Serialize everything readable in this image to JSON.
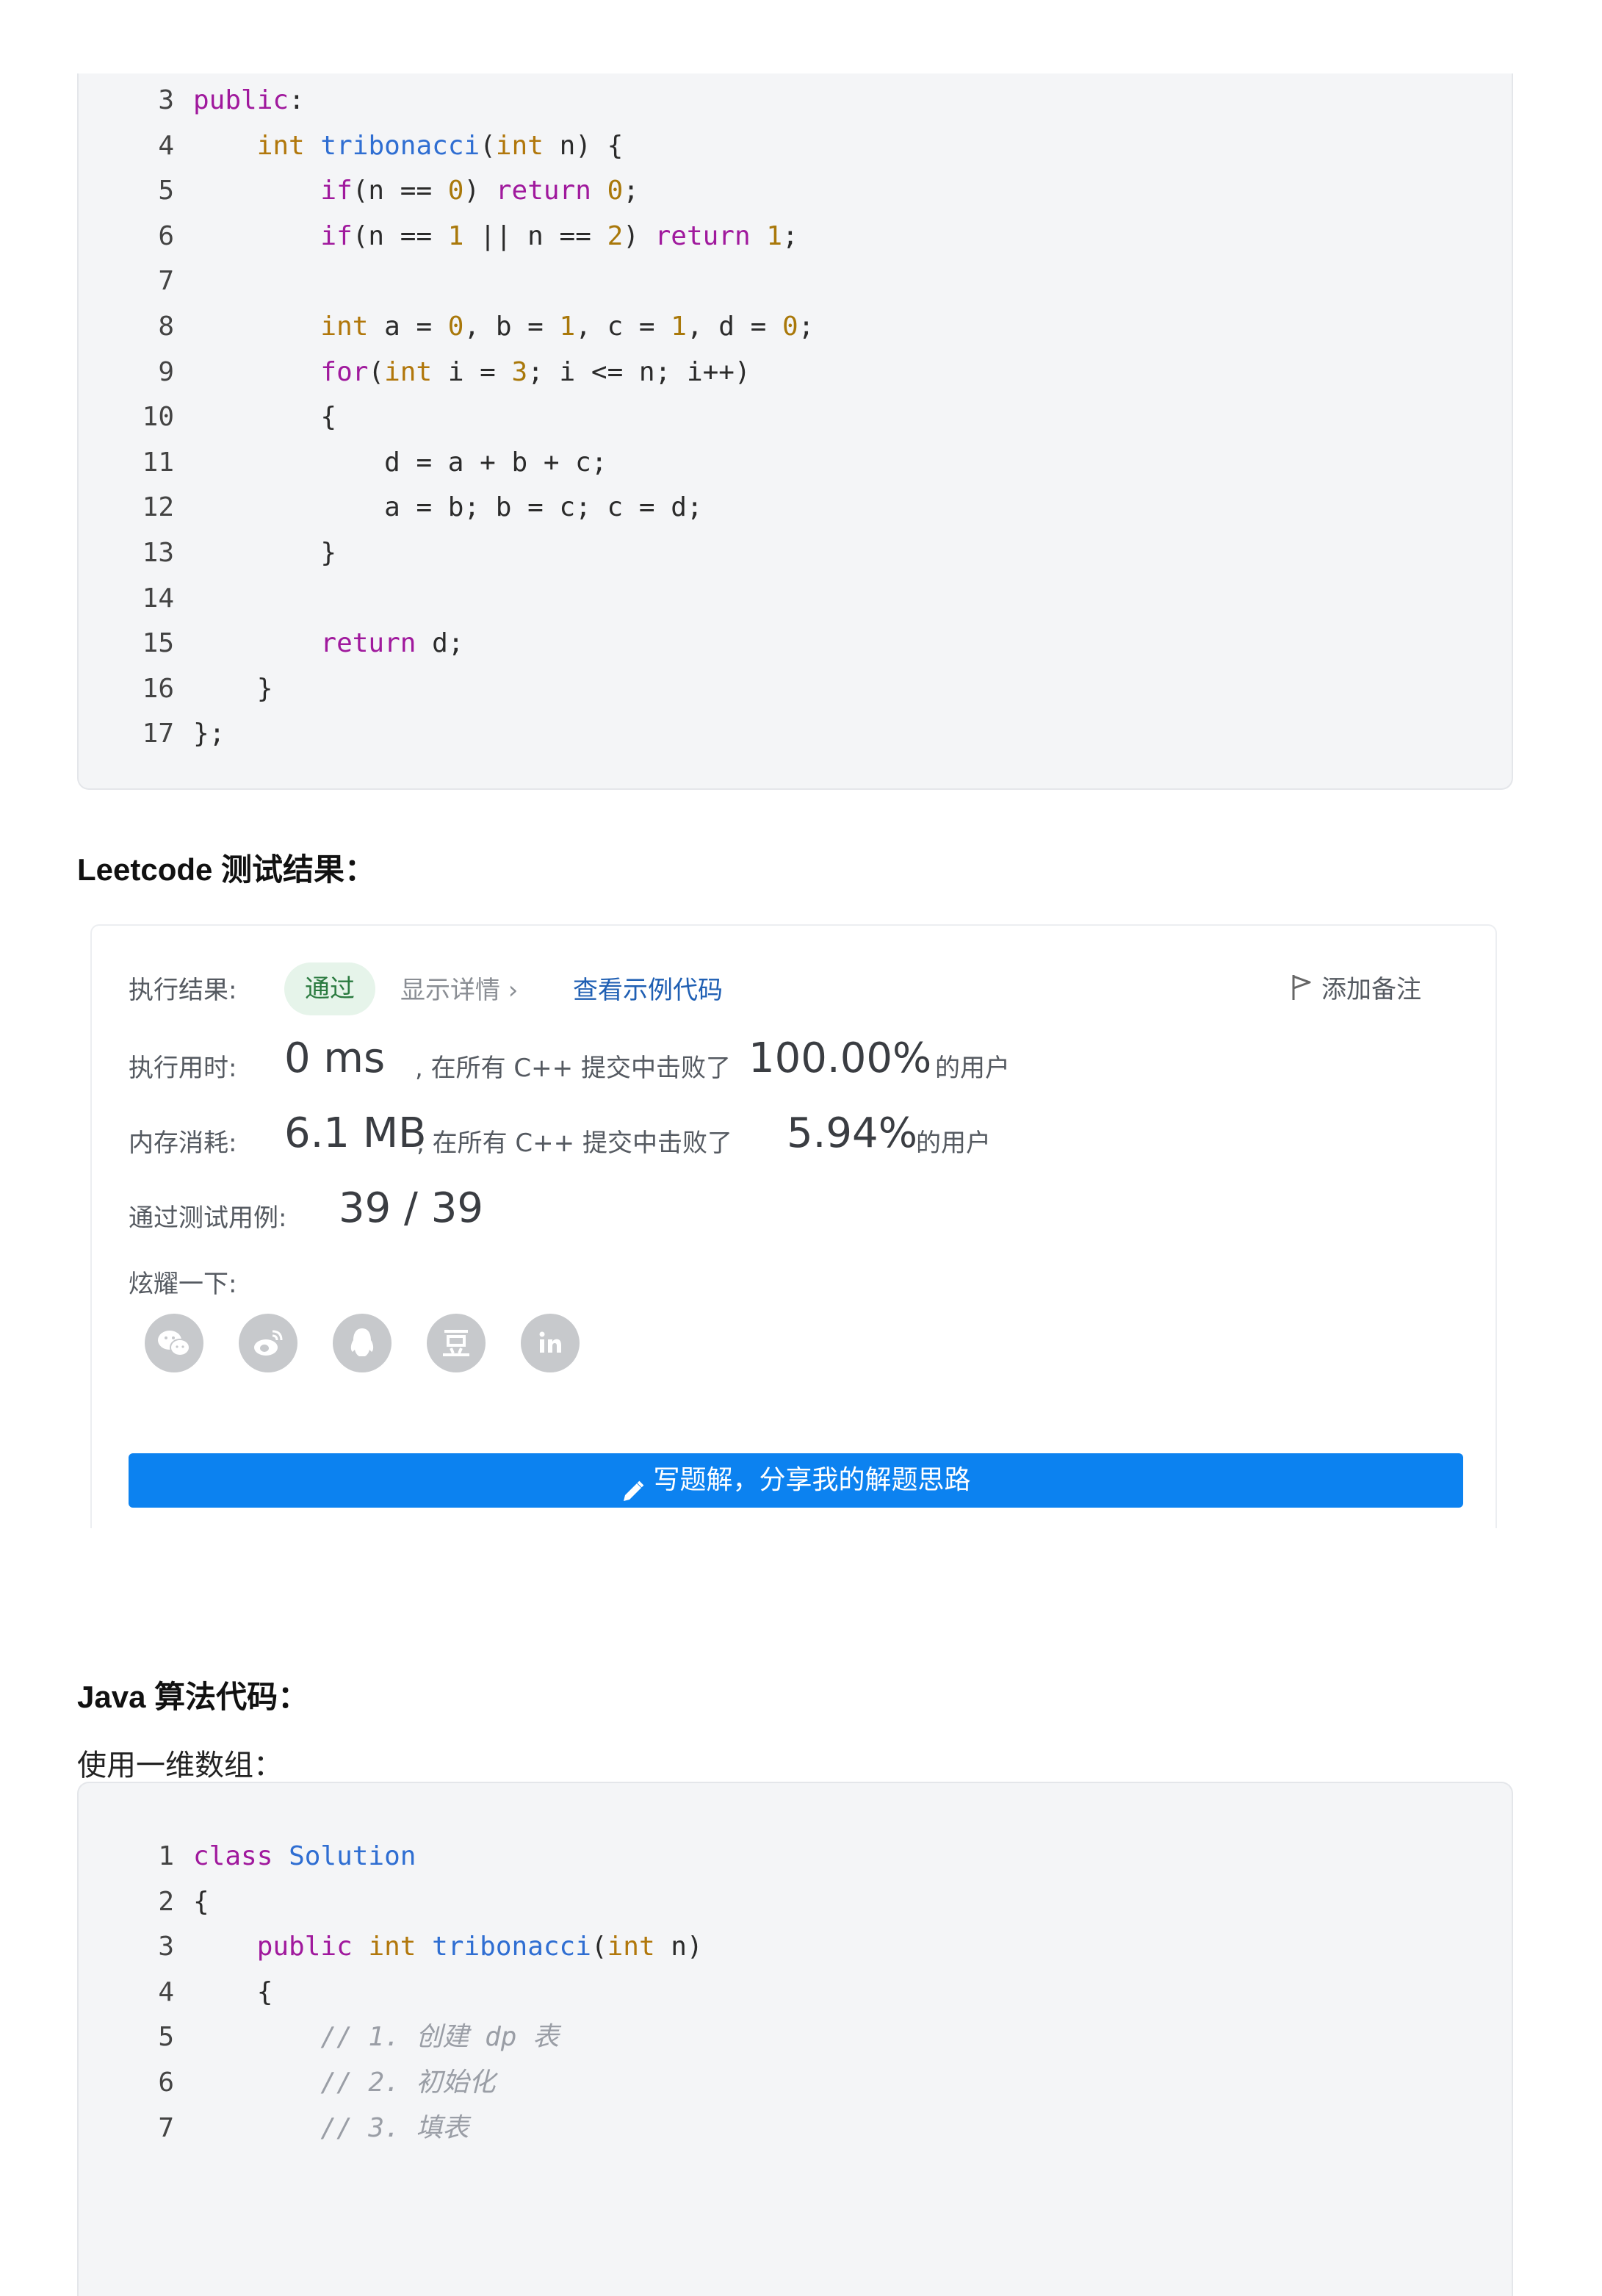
{
  "code_block_1": {
    "lines": [
      {
        "n": "3",
        "indent": 0,
        "tokens": [
          {
            "t": "public",
            "c": "kw"
          },
          {
            "t": ":",
            "c": ""
          }
        ]
      },
      {
        "n": "4",
        "indent": 1,
        "tokens": [
          {
            "t": "int",
            "c": "ty"
          },
          {
            "t": " ",
            "c": ""
          },
          {
            "t": "tribonacci",
            "c": "fn"
          },
          {
            "t": "(",
            "c": ""
          },
          {
            "t": "int",
            "c": "ty"
          },
          {
            "t": " n) {",
            "c": ""
          }
        ]
      },
      {
        "n": "5",
        "indent": 2,
        "tokens": [
          {
            "t": "if",
            "c": "kw"
          },
          {
            "t": "(n == ",
            "c": ""
          },
          {
            "t": "0",
            "c": "num"
          },
          {
            "t": ") ",
            "c": ""
          },
          {
            "t": "return",
            "c": "kw"
          },
          {
            "t": " ",
            "c": ""
          },
          {
            "t": "0",
            "c": "num"
          },
          {
            "t": ";",
            "c": ""
          }
        ]
      },
      {
        "n": "6",
        "indent": 2,
        "tokens": [
          {
            "t": "if",
            "c": "kw"
          },
          {
            "t": "(n == ",
            "c": ""
          },
          {
            "t": "1",
            "c": "num"
          },
          {
            "t": " || n == ",
            "c": ""
          },
          {
            "t": "2",
            "c": "num"
          },
          {
            "t": ") ",
            "c": ""
          },
          {
            "t": "return",
            "c": "kw"
          },
          {
            "t": " ",
            "c": ""
          },
          {
            "t": "1",
            "c": "num"
          },
          {
            "t": ";",
            "c": ""
          }
        ]
      },
      {
        "n": "7",
        "indent": 0,
        "tokens": []
      },
      {
        "n": "8",
        "indent": 2,
        "tokens": [
          {
            "t": "int",
            "c": "ty"
          },
          {
            "t": " a = ",
            "c": ""
          },
          {
            "t": "0",
            "c": "num"
          },
          {
            "t": ", b = ",
            "c": ""
          },
          {
            "t": "1",
            "c": "num"
          },
          {
            "t": ", c = ",
            "c": ""
          },
          {
            "t": "1",
            "c": "num"
          },
          {
            "t": ", d = ",
            "c": ""
          },
          {
            "t": "0",
            "c": "num"
          },
          {
            "t": ";",
            "c": ""
          }
        ]
      },
      {
        "n": "9",
        "indent": 2,
        "tokens": [
          {
            "t": "for",
            "c": "kw"
          },
          {
            "t": "(",
            "c": ""
          },
          {
            "t": "int",
            "c": "ty"
          },
          {
            "t": " i = ",
            "c": ""
          },
          {
            "t": "3",
            "c": "num"
          },
          {
            "t": "; i <= n; i++)",
            "c": ""
          }
        ]
      },
      {
        "n": "10",
        "indent": 2,
        "tokens": [
          {
            "t": "{",
            "c": ""
          }
        ]
      },
      {
        "n": "11",
        "indent": 3,
        "tokens": [
          {
            "t": "d = a + b + c;",
            "c": ""
          }
        ]
      },
      {
        "n": "12",
        "indent": 3,
        "tokens": [
          {
            "t": "a = b; b = c; c = d;",
            "c": ""
          }
        ]
      },
      {
        "n": "13",
        "indent": 2,
        "tokens": [
          {
            "t": "}",
            "c": ""
          }
        ]
      },
      {
        "n": "14",
        "indent": 0,
        "tokens": []
      },
      {
        "n": "15",
        "indent": 2,
        "tokens": [
          {
            "t": "return",
            "c": "kw"
          },
          {
            "t": " d;",
            "c": ""
          }
        ]
      },
      {
        "n": "16",
        "indent": 1,
        "tokens": [
          {
            "t": "}",
            "c": ""
          }
        ]
      },
      {
        "n": "17",
        "indent": 0,
        "tokens": [
          {
            "t": "};",
            "c": ""
          }
        ]
      }
    ]
  },
  "heading_leetcode": "Leetcode 测试结果：",
  "result": {
    "status_label": "执行结果:",
    "status_badge": "通过",
    "show_details": "显示详情 ›",
    "view_sample": "查看示例代码",
    "add_note": "添加备注",
    "time_label": "执行用时:",
    "time_value": "0 ms",
    "time_text": ", 在所有 C++ 提交中击败了",
    "time_percent": "100.00%",
    "time_suffix": "的用户",
    "mem_label": "内存消耗:",
    "mem_value": "6.1 MB",
    "mem_text": ", 在所有 C++ 提交中击败了",
    "mem_percent": "5.94%",
    "mem_suffix": "的用户",
    "cases_label": "通过测试用例:",
    "cases_value": "39 / 39",
    "share_label": "炫耀一下:",
    "share_icons": [
      "wechat-icon",
      "weibo-icon",
      "qq-icon",
      "douban-icon",
      "linkedin-icon"
    ],
    "solution_button": "写题解，分享我的解题思路",
    "colors": {
      "badge_bg": "#e6f4ea",
      "badge_text": "#2a7a3f",
      "link": "#1f5fb3",
      "button_bg": "#0c82f0"
    }
  },
  "heading_java": "Java 算法代码：",
  "para_1d": "使用一维数组：",
  "code_block_2": {
    "lines": [
      {
        "n": "1",
        "indent": 0,
        "tokens": [
          {
            "t": "class",
            "c": "kw"
          },
          {
            "t": " ",
            "c": ""
          },
          {
            "t": "Solution",
            "c": "fn"
          }
        ]
      },
      {
        "n": "2",
        "indent": 0,
        "tokens": [
          {
            "t": "{",
            "c": ""
          }
        ]
      },
      {
        "n": "3",
        "indent": 1,
        "tokens": [
          {
            "t": "public",
            "c": "kw"
          },
          {
            "t": " ",
            "c": ""
          },
          {
            "t": "int",
            "c": "ty"
          },
          {
            "t": " ",
            "c": ""
          },
          {
            "t": "tribonacci",
            "c": "fn"
          },
          {
            "t": "(",
            "c": ""
          },
          {
            "t": "int",
            "c": "ty"
          },
          {
            "t": " n)",
            "c": ""
          }
        ]
      },
      {
        "n": "4",
        "indent": 1,
        "tokens": [
          {
            "t": "{",
            "c": ""
          }
        ]
      },
      {
        "n": "5",
        "indent": 2,
        "tokens": [
          {
            "t": "// 1. 创建 dp 表",
            "c": "cm"
          }
        ]
      },
      {
        "n": "6",
        "indent": 2,
        "tokens": [
          {
            "t": "// 2. 初始化",
            "c": "cm"
          }
        ]
      },
      {
        "n": "7",
        "indent": 2,
        "tokens": [
          {
            "t": "// 3. 填表",
            "c": "cm"
          }
        ]
      }
    ]
  }
}
